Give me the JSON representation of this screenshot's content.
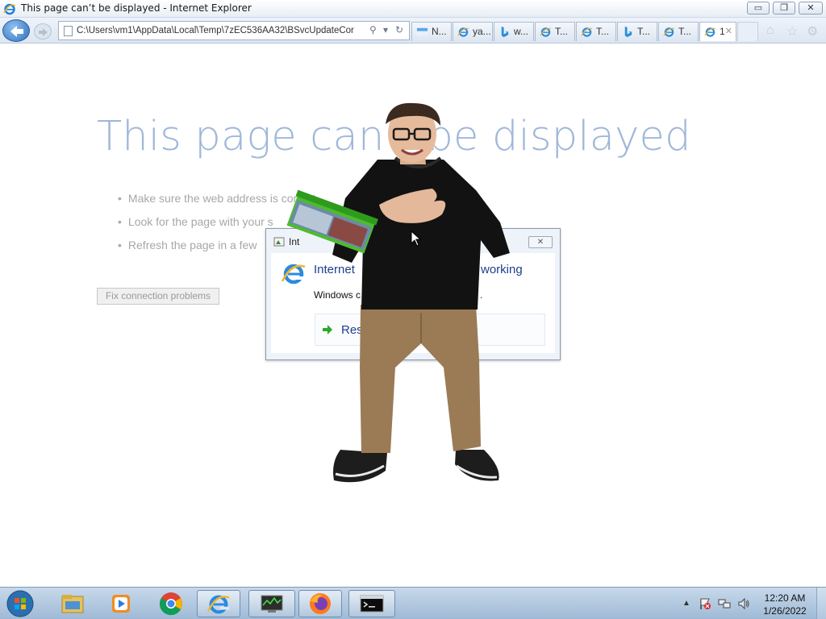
{
  "window": {
    "title": "This page can’t be displayed - Internet Explorer",
    "buttons": {
      "minimize": "▭",
      "maximize": "❐",
      "close": "✕"
    }
  },
  "nav": {
    "address": "C:\\Users\\vm1\\AppData\\Local\\Temp\\7zEC536AA32\\BSvcUpdateCor",
    "tabs": [
      {
        "label": "N...",
        "icon": "msn-icon"
      },
      {
        "label": "ya...",
        "icon": "ie-icon"
      },
      {
        "label": "w...",
        "icon": "bing-icon"
      },
      {
        "label": "T...",
        "icon": "ie-icon"
      },
      {
        "label": "T...",
        "icon": "ie-icon"
      },
      {
        "label": "T...",
        "icon": "bing-icon"
      },
      {
        "label": "T...",
        "icon": "ie-icon"
      },
      {
        "label": "1",
        "icon": "ie-icon",
        "active": true
      }
    ],
    "tab_close": "✕",
    "icons": [
      "home-icon",
      "favorites-star-icon",
      "tools-gear-icon"
    ]
  },
  "page": {
    "title": "This page can’t be displayed",
    "bullets": [
      "Make sure the web address is correct.",
      "Look for the page with your s",
      "Refresh the page in a few"
    ],
    "fix_button": "Fix connection problems"
  },
  "dialog": {
    "title": "Int",
    "close": "✕",
    "heading_left": "Internet",
    "heading_right": "working",
    "message_left": "Windows c",
    "message_right": ".",
    "restart_label": "Res"
  },
  "taskbar": {
    "pinned": [
      "explorer-folder-icon",
      "media-player-icon",
      "chrome-icon",
      "internet-explorer-icon",
      "task-manager-icon",
      "firefox-icon",
      "command-prompt-icon"
    ],
    "tray_arrow": "▲",
    "time": "12:20 AM",
    "date": "1/26/2022"
  }
}
